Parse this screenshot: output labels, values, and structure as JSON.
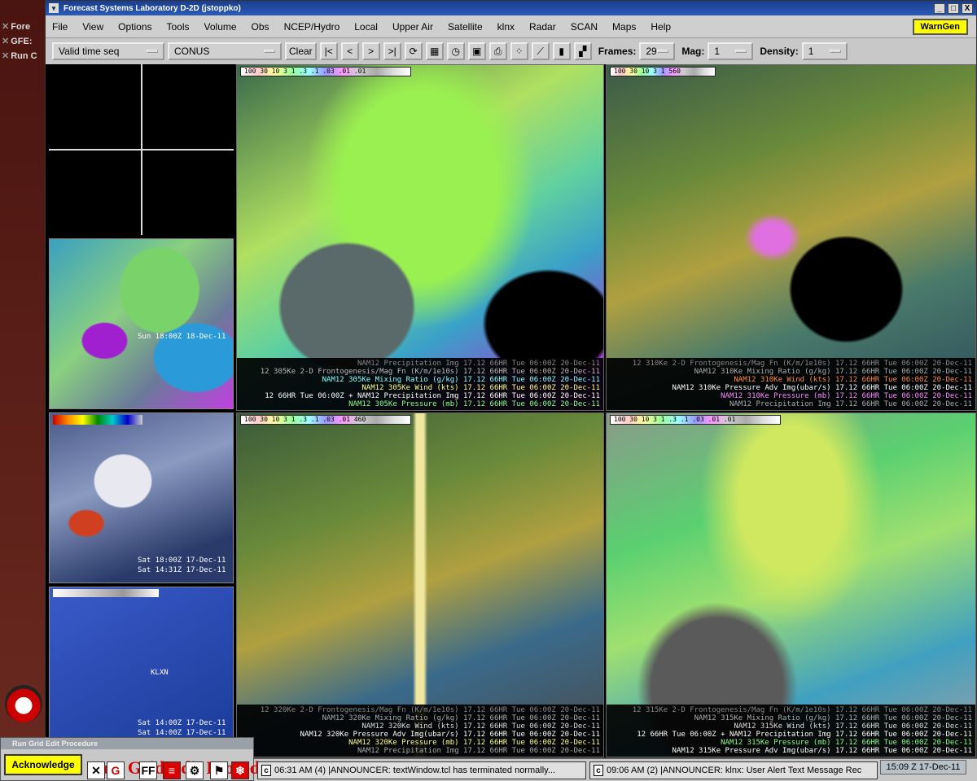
{
  "desktop": {
    "items": [
      "Fore",
      "GFE:",
      "Run C"
    ]
  },
  "window": {
    "title": "Forecast Systems Laboratory D-2D (jstoppko)",
    "controls": [
      "_",
      "□",
      "X"
    ]
  },
  "menu": {
    "items": [
      "File",
      "View",
      "Options",
      "Tools",
      "Volume",
      "Obs",
      "NCEP/Hydro",
      "Local",
      "Upper Air",
      "Satellite",
      "klnx",
      "Radar",
      "SCAN",
      "Maps",
      "Help"
    ],
    "warngen": "WarnGen"
  },
  "toolbar": {
    "time_combo": "Valid time seq",
    "scale_combo": "CONUS",
    "clear": "Clear",
    "frames_label": "Frames:",
    "frames_value": "29",
    "mag_label": "Mag:",
    "mag_value": "1",
    "density_label": "Density:",
    "density_value": "1"
  },
  "thumbnails": {
    "thumb1_time": "Sun 18:00Z 18-Dec-11",
    "thumb2_time1": "Sat 18:00Z 17-Dec-11",
    "thumb2_time2": "Sat 14:31Z 17-Dec-11",
    "thumb3_time1": "Sat 14:00Z 17-Dec-11",
    "thumb3_time2": "Sat 14:00Z 17-Dec-11",
    "thumb3_station": "KLXN"
  },
  "panels": {
    "top_left": {
      "colorbar": "100 30 10 3 1 .3 .1 .03 .01 .01",
      "legend": [
        "NAM12 Precipitation Img   17.12   66HR Tue 06:00Z 20-Dec-11",
        "12 305Ke 2-D Frontogenesis/Mag Fn (K/m/1e10s)  17.12   66HR Tue 06:00Z 20-Dec-11",
        "NAM12 305Ke Mixing Ratio (g/kg)  17.12   66HR Tue 06:00Z 20-Dec-11",
        "NAM12 305Ke Wind (kts)  17.12   66HR Tue 06:00Z 20-Dec-11",
        "12  66HR Tue 06:00Z + NAM12 Precipitation Img  17.12   66HR Tue 06:00Z 20-Dec-11",
        "NAM12 305Ke Pressure (mb)  17.12   66HR Tue 06:00Z 20-Dec-11"
      ]
    },
    "top_right": {
      "colorbar": "100 30 10 3 1 560",
      "legend": [
        "12 310Ke 2-D Frontogenesis/Mag Fn (K/m/1e10s)  17.12   66HR Tue 06:00Z 20-Dec-11",
        "NAM12 310Ke Mixing Ratio (g/kg)  17.12   66HR Tue 06:00Z 20-Dec-11",
        "NAM12 310Ke Wind (kts)  17.12   66HR Tue 06:00Z 20-Dec-11",
        "NAM12 310Ke Pressure Adv Img(ubar/s)  17.12   66HR Tue 06:00Z 20-Dec-11",
        "NAM12 310Ke Pressure (mb)  17.12   66HR Tue 06:00Z 20-Dec-11",
        "NAM12 Precipitation Img  17.12   66HR Tue 06:00Z 20-Dec-11"
      ]
    },
    "bottom_left": {
      "colorbar": "100 30 10 3 1 .3 .1 .03 .01 460",
      "legend": [
        "12 320Ke 2-D Frontogenesis/Mag Fn (K/m/1e10s)  17.12   66HR Tue 06:00Z 20-Dec-11",
        "NAM12 320Ke Mixing Ratio (g/kg)  17.12   66HR Tue 06:00Z 20-Dec-11",
        "NAM12 320Ke Wind (kts)  17.12   66HR Tue 06:00Z 20-Dec-11",
        "NAM12 320Ke Pressure Adv Img(ubar/s)  17.12   66HR Tue 06:00Z 20-Dec-11",
        "NAM12 320Ke Pressure (mb)  17.12   66HR Tue 06:00Z 20-Dec-11",
        "NAM12 Precipitation Img  17.12   66HR Tue 06:00Z 20-Dec-11"
      ]
    },
    "bottom_right": {
      "colorbar": "100 30 10 3 1 .3 .1 .03 .01 .01",
      "legend": [
        "12 315Ke 2-D Frontogenesis/Mag Fn (K/m/1e10s)  17.12   66HR Tue 06:00Z 20-Dec-11",
        "NAM12 315Ke Mixing Ratio (g/kg)  17.12   66HR Tue 06:00Z 20-Dec-11",
        "NAM12 315Ke Wind (kts)  17.12   66HR Tue 06:00Z 20-Dec-11",
        "12  66HR Tue 06:00Z + NAM12 Precipitation Img  17.12   66HR Tue 06:00Z 20-Dec-11",
        "NAM12 315Ke Pressure (mb)  17.12   66HR Tue 06:00Z 20-Dec-11",
        "NAM12 315Ke Pressure Adv Img(ubar/s)  17.12   66HR Tue 06:00Z 20-Dec-11"
      ]
    }
  },
  "taskbar": {
    "procedure_title": "Run Grid Edit Procedure",
    "acknowledge": "Acknowledge",
    "procedure_text": "Run Grid Edit Procedure",
    "icon_ff": "FF",
    "announce1": "06:31 AM (4) |ANNOUNCER: textWindow.tcl has terminated normally...",
    "announce2": "09:06 AM (2) |ANNOUNCER: klnx: User Alert Text Message Rec",
    "clock": "15:09 Z 17-Dec-11"
  }
}
